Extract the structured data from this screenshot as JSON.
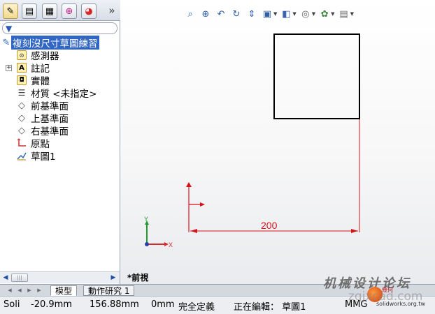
{
  "tabs": [
    {
      "name": "featuremanager",
      "icon": "feature-tree-icon",
      "glyph": "✎"
    },
    {
      "name": "propertymanager",
      "icon": "property-manager-icon",
      "glyph": "▤"
    },
    {
      "name": "configurationmanager",
      "icon": "configuration-icon",
      "glyph": "▦"
    },
    {
      "name": "dimxpert",
      "icon": "dimxpert-icon",
      "glyph": "⊕"
    },
    {
      "name": "display",
      "icon": "display-pie-icon",
      "glyph": "◕"
    }
  ],
  "tab_more": "»",
  "tree": {
    "root": "複刻沒尺寸草圖練習",
    "items": [
      {
        "label": "感測器",
        "icon": "sensor-icon"
      },
      {
        "label": "註記",
        "icon": "annotation-icon"
      },
      {
        "label": "實體",
        "icon": "solid-body-icon"
      },
      {
        "label": "材質 <未指定>",
        "icon": "material-icon"
      },
      {
        "label": "前基準面",
        "icon": "plane-icon"
      },
      {
        "label": "上基準面",
        "icon": "plane-icon"
      },
      {
        "label": "右基準面",
        "icon": "plane-icon"
      },
      {
        "label": "原點",
        "icon": "origin-icon"
      },
      {
        "label": "草圖1",
        "icon": "sketch-icon"
      }
    ]
  },
  "viewport": {
    "dimension_value": "200",
    "view_name": "*前視",
    "triad_x": "X",
    "triad_y": "Y"
  },
  "sheet_tabs": [
    "模型",
    "動作研究 1"
  ],
  "status": {
    "app": "Soli",
    "x": "-20.9mm",
    "y": "156.88mm",
    "z": "0mm",
    "definition": "完全定義",
    "editing": "正在編輯： 草圖1",
    "units": "MMG"
  },
  "watermark": {
    "text": "机械设计论坛",
    "url": "zgjxcad.com",
    "url2": "solidworks.org.tw",
    "brand": "幾何"
  },
  "colors": {
    "selection": "#3166c4",
    "sketch_defined": "#000000",
    "dimension": "#d4141a"
  }
}
